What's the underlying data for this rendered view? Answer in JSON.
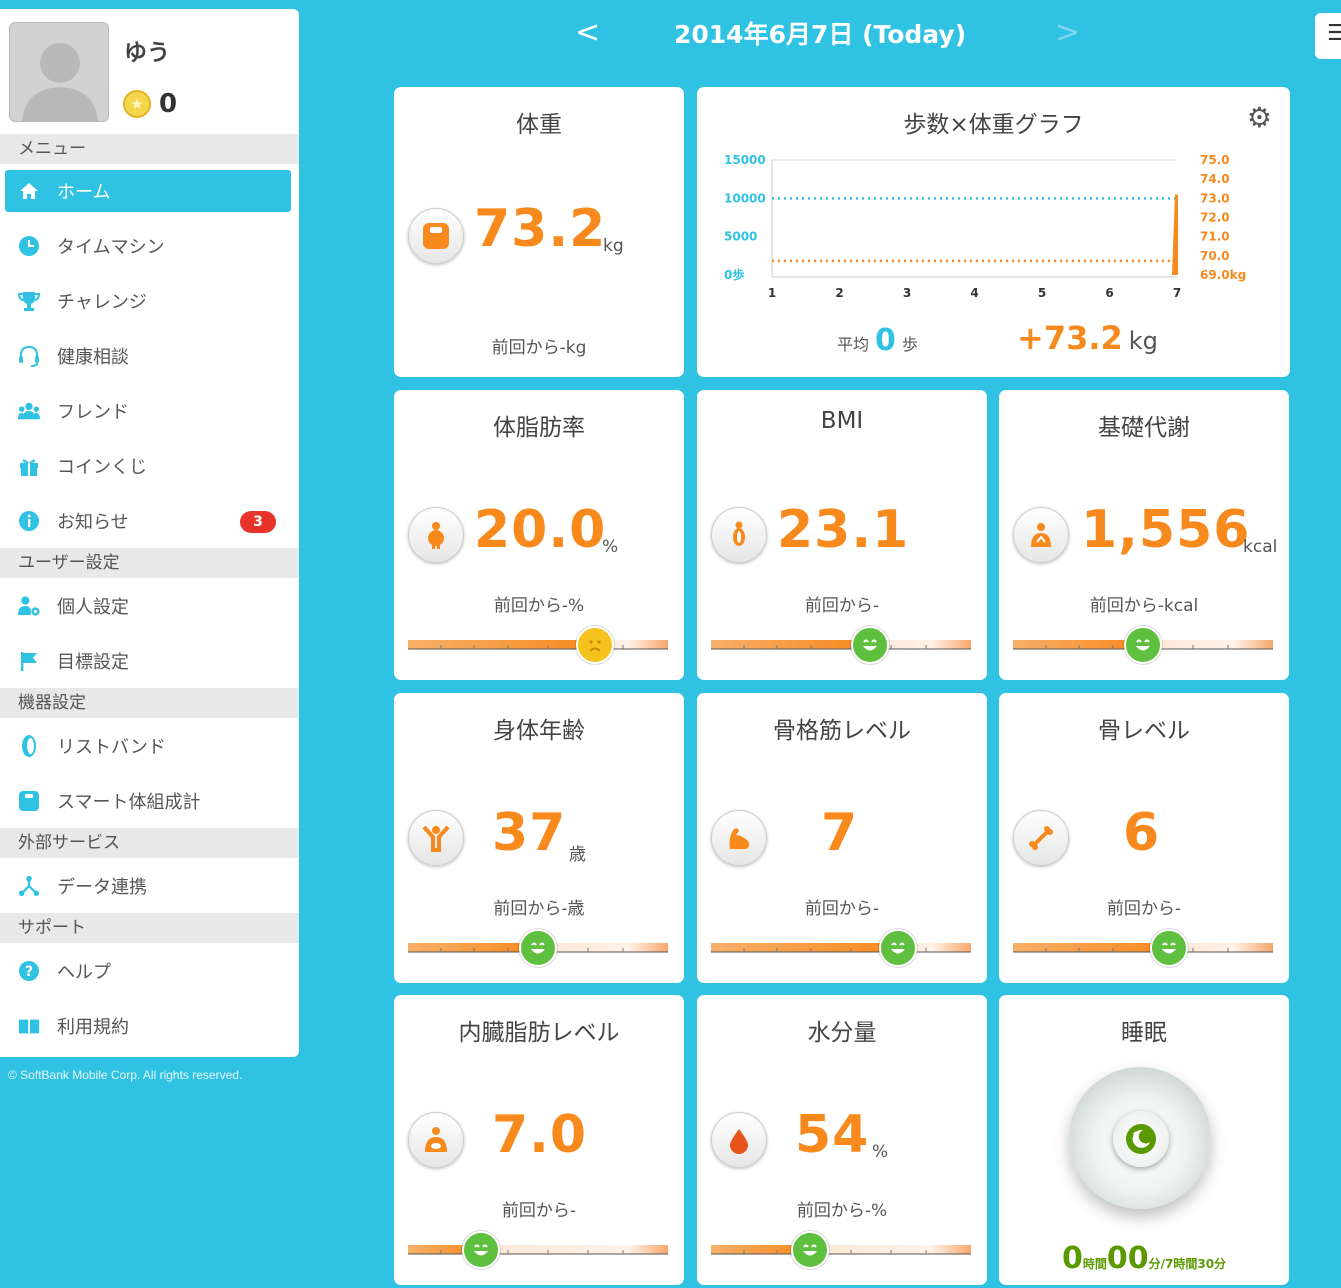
{
  "user": {
    "name": "ゆう",
    "coins": "0"
  },
  "sidebar": {
    "sections": [
      {
        "label": "メニュー",
        "items": [
          {
            "label": "ホーム",
            "icon": "home-icon",
            "active": true
          },
          {
            "label": "タイムマシン",
            "icon": "clock-icon"
          },
          {
            "label": "チャレンジ",
            "icon": "trophy-icon"
          },
          {
            "label": "健康相談",
            "icon": "headset-icon"
          },
          {
            "label": "フレンド",
            "icon": "friends-icon"
          },
          {
            "label": "コインくじ",
            "icon": "gift-icon"
          },
          {
            "label": "お知らせ",
            "icon": "info-icon",
            "badge": "3"
          }
        ]
      },
      {
        "label": "ユーザー設定",
        "items": [
          {
            "label": "個人設定",
            "icon": "user-settings-icon"
          },
          {
            "label": "目標設定",
            "icon": "flag-icon"
          }
        ]
      },
      {
        "label": "機器設定",
        "items": [
          {
            "label": "リストバンド",
            "icon": "wristband-icon"
          },
          {
            "label": "スマート体組成計",
            "icon": "scale-icon"
          }
        ]
      },
      {
        "label": "外部サービス",
        "items": [
          {
            "label": "データ連携",
            "icon": "link-icon"
          }
        ]
      },
      {
        "label": "サポート",
        "items": [
          {
            "label": "ヘルプ",
            "icon": "help-icon"
          },
          {
            "label": "利用規約",
            "icon": "book-icon"
          }
        ]
      }
    ]
  },
  "copyright": "© SoftBank Mobile Corp. All rights reserved.",
  "nav": {
    "prev": "<",
    "date": "2014年6月7日 (Today)",
    "next": ">",
    "menu": "☰"
  },
  "cards": {
    "weight": {
      "title": "体重",
      "value": "73.2",
      "unit": "kg",
      "prev": "前回から-kg"
    },
    "bodyfat": {
      "title": "体脂肪率",
      "value": "20.0",
      "unit": "%",
      "prev": "前回から-%",
      "level": 0.72,
      "mood": "bad"
    },
    "bmi": {
      "title": "BMI",
      "value": "23.1",
      "unit": "",
      "prev": "前回から-",
      "level": 0.61,
      "mood": "good"
    },
    "bmr": {
      "title": "基礎代謝",
      "value": "1,556",
      "unit": "kcal",
      "prev": "前回から-kcal",
      "level": 0.5,
      "mood": "good"
    },
    "bodyage": {
      "title": "身体年齢",
      "value": "37",
      "unit": "歳",
      "prev": "前回から-歳",
      "level": 0.5,
      "mood": "good"
    },
    "muscle": {
      "title": "骨格筋レベル",
      "value": "7",
      "unit": "",
      "prev": "前回から-",
      "level": 0.72,
      "mood": "good"
    },
    "bone": {
      "title": "骨レベル",
      "value": "6",
      "unit": "",
      "prev": "前回から-",
      "level": 0.6,
      "mood": "good"
    },
    "visceral": {
      "title": "内臓脂肪レベル",
      "value": "7.0",
      "unit": "",
      "prev": "前回から-",
      "level": 0.28,
      "mood": "good"
    },
    "water": {
      "title": "水分量",
      "value": "54",
      "unit": "%",
      "prev": "前回から-%",
      "level": 0.38,
      "mood": "good"
    },
    "sleep": {
      "title": "睡眠",
      "hours": "0",
      "hours_unit": "時間",
      "minutes": "00",
      "minutes_unit": "分",
      "goal": "/7時間30分"
    }
  },
  "chart_data": {
    "type": "line",
    "title": "歩数×体重グラフ",
    "x": [
      "1",
      "2",
      "3",
      "4",
      "5",
      "6",
      "7"
    ],
    "left_axis": {
      "ticks": [
        "15000",
        "10000",
        "5000",
        "0歩"
      ],
      "range": [
        0,
        15000
      ]
    },
    "right_axis": {
      "ticks": [
        "75.0",
        "74.0",
        "73.0",
        "72.0",
        "71.0",
        "70.0",
        "69.0kg"
      ],
      "range": [
        69.0,
        75.0
      ]
    },
    "series": [
      {
        "name": "歩数",
        "values": [
          0,
          0,
          0,
          0,
          0,
          0,
          0
        ],
        "color": "#2fc2e3",
        "target": 10000
      },
      {
        "name": "体重",
        "values": [
          null,
          null,
          null,
          null,
          null,
          null,
          73.2
        ],
        "color": "#f7891d",
        "target": 70.0
      }
    ],
    "average_label": "平均",
    "average_value": "0",
    "average_unit": "歩",
    "delta_value": "+73.2",
    "delta_unit": "kg"
  },
  "colors": {
    "accent": "#2fc2e3",
    "value": "#f7891d",
    "good": "#5fbf3f",
    "bad": "#f5c21e",
    "badge": "#e8332b"
  }
}
